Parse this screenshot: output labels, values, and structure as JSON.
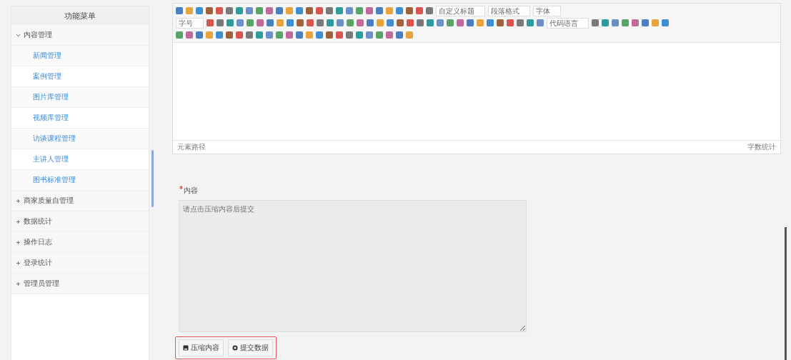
{
  "sidebar": {
    "title": "功能菜单",
    "groups": [
      {
        "label": "内容管理",
        "expanded": true,
        "children": [
          {
            "label": "新闻管理"
          },
          {
            "label": "案例管理"
          },
          {
            "label": "图片库管理"
          },
          {
            "label": "视频库管理"
          },
          {
            "label": "访谈课程管理"
          },
          {
            "label": "主讲人管理"
          },
          {
            "label": "图书标准管理"
          }
        ]
      },
      {
        "label": "商家质量自管理",
        "expanded": false
      },
      {
        "label": "数据统计",
        "expanded": false
      },
      {
        "label": "操作日志",
        "expanded": false
      },
      {
        "label": "登录统计",
        "expanded": false
      },
      {
        "label": "管理员管理",
        "expanded": false
      }
    ]
  },
  "editor": {
    "toolbar_selects": [
      "自定义标题",
      "段落格式",
      "字体",
      "字号",
      "代码语言"
    ],
    "status_left": "元素路径",
    "status_right": "字数统计"
  },
  "content_field": {
    "label": "内容",
    "required": true,
    "placeholder": "请点击压缩内容后提交"
  },
  "buttons": [
    {
      "label": "压缩内容",
      "kind": "compress"
    },
    {
      "label": "提交数据",
      "kind": "submit"
    }
  ]
}
